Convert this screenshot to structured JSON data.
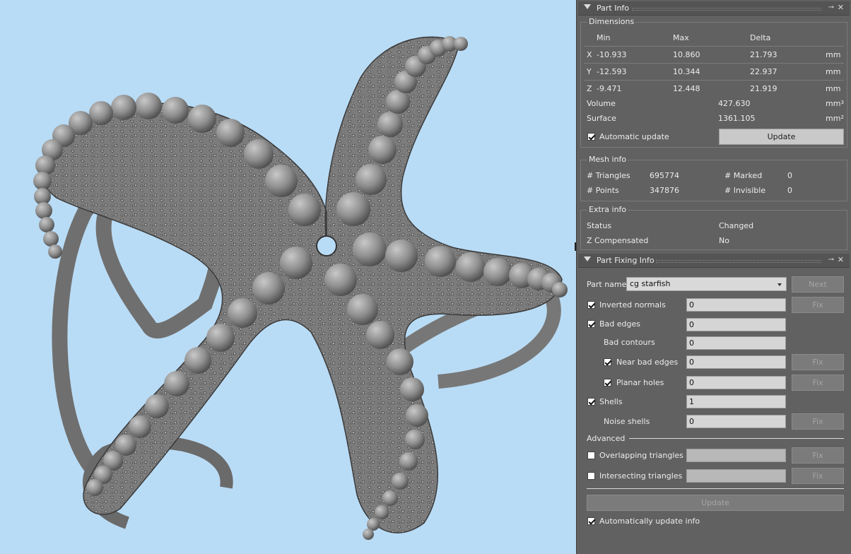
{
  "part_info": {
    "title": "Part Info",
    "dimensions": {
      "group_title": "Dimensions",
      "columns": [
        "Min",
        "Max",
        "Delta"
      ],
      "rows": [
        {
          "axis": "X",
          "min": "-10.933",
          "max": "10.860",
          "delta": "21.793",
          "unit": "mm"
        },
        {
          "axis": "Y",
          "min": "-12.593",
          "max": "10.344",
          "delta": "22.937",
          "unit": "mm"
        },
        {
          "axis": "Z",
          "min": "-9.471",
          "max": "12.448",
          "delta": "21.919",
          "unit": "mm"
        }
      ],
      "volume_label": "Volume",
      "volume_value": "427.630",
      "volume_unit": "mm",
      "surface_label": "Surface",
      "surface_value": "1361.105",
      "surface_unit": "mm",
      "unit_volume_exp": "3",
      "unit_surface_exp": "2",
      "auto_update_label": "Automatic update",
      "auto_update_checked": true,
      "update_button": "Update"
    },
    "mesh_info": {
      "group_title": "Mesh info",
      "triangles_label": "# Triangles",
      "triangles_value": "695774",
      "points_label": "# Points",
      "points_value": "347876",
      "marked_label": "# Marked",
      "marked_value": "0",
      "invisible_label": "# Invisible",
      "invisible_value": "0"
    },
    "extra_info": {
      "group_title": "Extra info",
      "status_label": "Status",
      "status_value": "Changed",
      "zcomp_label": "Z Compensated",
      "zcomp_value": "No"
    }
  },
  "part_fixing": {
    "title": "Part Fixing Info",
    "part_name_label": "Part name",
    "part_name_value": "cg starfish",
    "next_button": "Next",
    "fix_label": "Fix",
    "items": {
      "inverted_normals": {
        "label": "Inverted normals",
        "value": "0",
        "checked": true
      },
      "bad_edges": {
        "label": "Bad edges",
        "value": "0",
        "checked": true
      },
      "bad_contours": {
        "label": "Bad contours",
        "value": "0"
      },
      "near_bad_edges": {
        "label": "Near bad edges",
        "value": "0",
        "checked": true
      },
      "planar_holes": {
        "label": "Planar holes",
        "value": "0",
        "checked": true
      },
      "shells": {
        "label": "Shells",
        "value": "1",
        "checked": true
      },
      "noise_shells": {
        "label": "Noise shells",
        "value": "0"
      }
    },
    "advanced_label": "Advanced",
    "overlapping": {
      "label": "Overlapping triangles",
      "checked": false
    },
    "intersecting": {
      "label": "Intersecting triangles",
      "checked": false
    },
    "update_button": "Update",
    "auto_update_info_label": "Automatically update info",
    "auto_update_info_checked": true
  },
  "viewport": {
    "background": "#b9dcf6",
    "model_color": "#8a8a8a"
  }
}
